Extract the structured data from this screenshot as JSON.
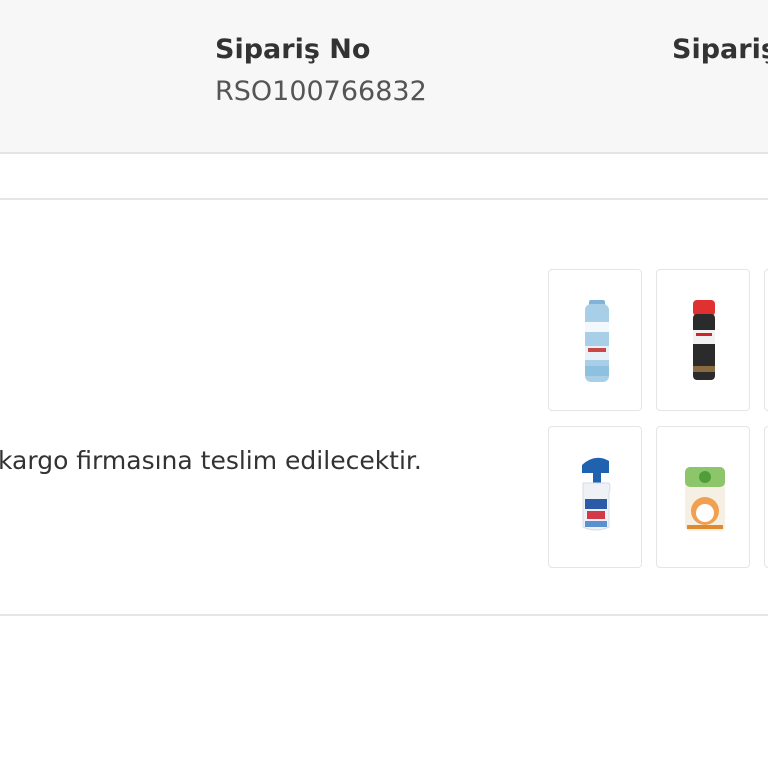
{
  "order_header": {
    "columns": [
      {
        "label": "Sipariş No",
        "value": "RSO100766832"
      },
      {
        "label": "Sipariş",
        "value": ""
      }
    ]
  },
  "shipment": {
    "delivery_text": "kargo firmasına teslim edilecektir.",
    "products": [
      {
        "icon": "blue-aerosol-can-icon"
      },
      {
        "icon": "red-cap-spray-can-icon"
      },
      {
        "icon": "blue-cap-cleaner-bottle-icon"
      },
      {
        "icon": "air-freshener-refill-icon"
      }
    ]
  },
  "colors": {
    "header_bg": "#f7f7f7",
    "divider": "#e6e6e6",
    "thumb_border": "#e5e5e5",
    "text": "#333333"
  }
}
